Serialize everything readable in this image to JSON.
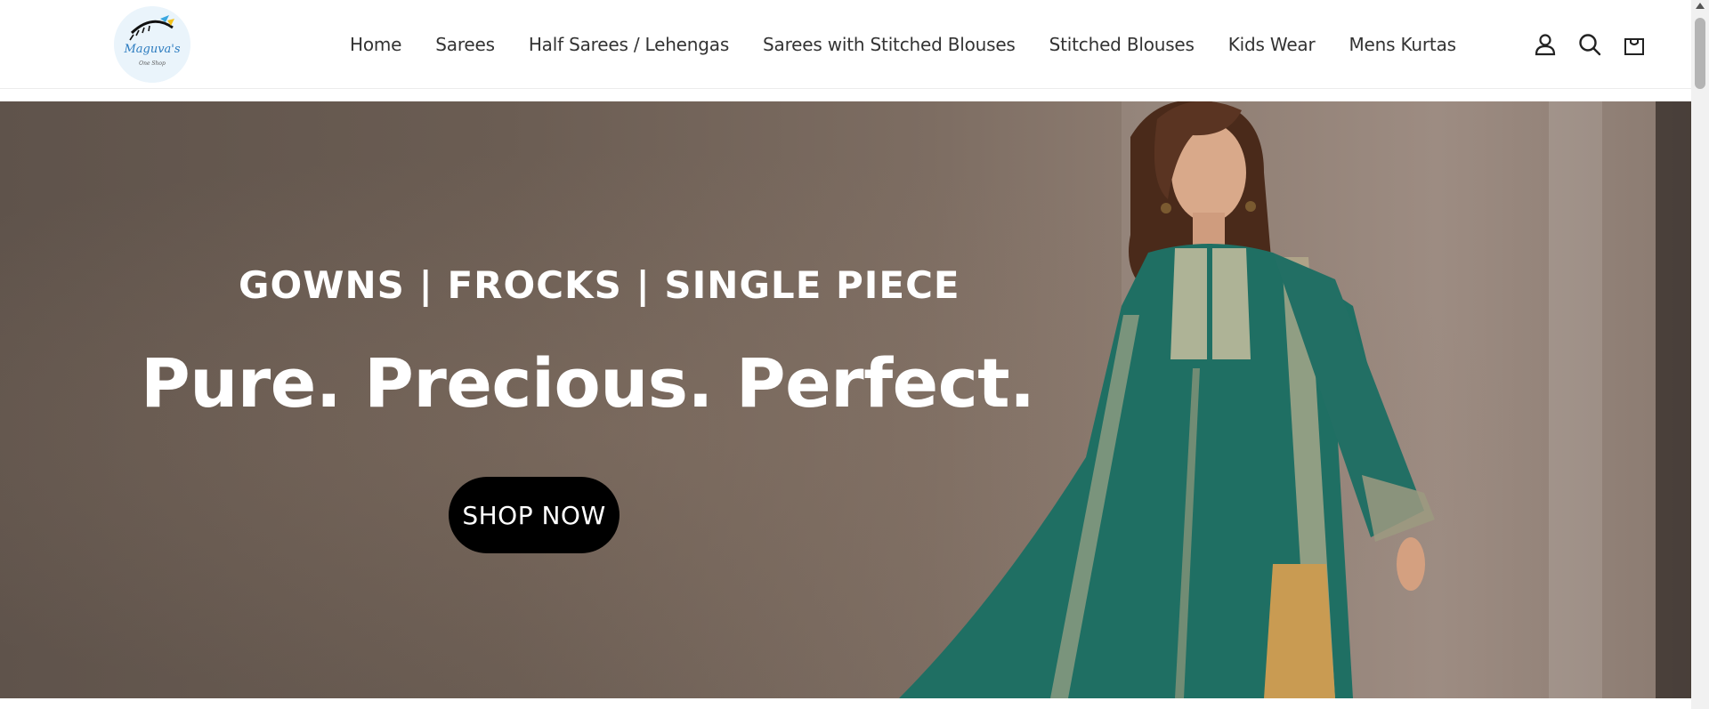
{
  "header": {
    "logo": {
      "text": "Maguva's",
      "tagline": "One Shop"
    },
    "nav": [
      {
        "label": "Home"
      },
      {
        "label": "Sarees"
      },
      {
        "label": "Half Sarees / Lehengas"
      },
      {
        "label": "Sarees with Stitched Blouses"
      },
      {
        "label": "Stitched Blouses"
      },
      {
        "label": "Kids Wear"
      },
      {
        "label": "Mens Kurtas"
      }
    ],
    "icons": [
      "account-icon",
      "search-icon",
      "cart-icon"
    ]
  },
  "hero": {
    "subtitle": "GOWNS | FROCKS |  SINGLE PIECE",
    "title": "Pure. Precious. Perfect.",
    "cta_label": "SHOP NOW"
  },
  "colors": {
    "text": "#333333",
    "cta_background": "#000000",
    "hero_background": "#6b5d53",
    "dress_green": "#1f6f63"
  }
}
